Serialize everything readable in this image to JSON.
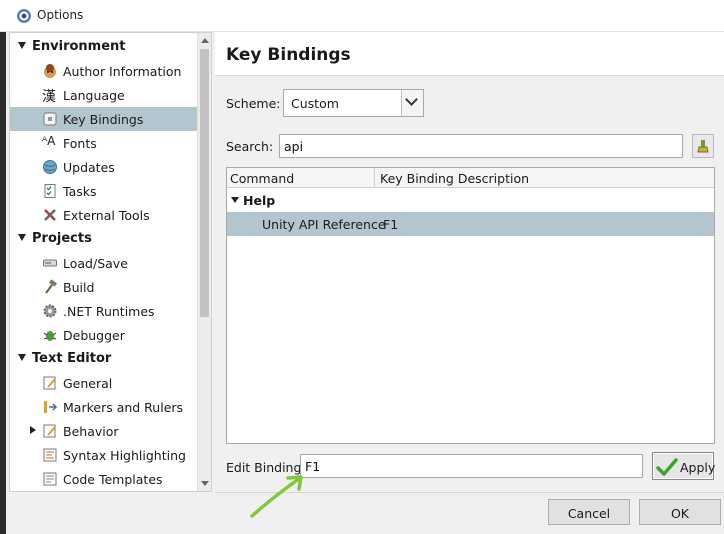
{
  "window": {
    "title": "Options"
  },
  "sidebar": {
    "categories": [
      {
        "label": "Environment",
        "items": [
          {
            "label": "Author Information",
            "icon": "author-face-icon"
          },
          {
            "label": "Language",
            "icon": "kanji-icon",
            "glyph": "漢"
          },
          {
            "label": "Key Bindings",
            "icon": "keyboard-key-icon",
            "selected": true
          },
          {
            "label": "Fonts",
            "icon": "font-size-icon",
            "glyph": "ᴬA"
          },
          {
            "label": "Updates",
            "icon": "globe-icon"
          },
          {
            "label": "Tasks",
            "icon": "checklist-icon"
          },
          {
            "label": "External Tools",
            "icon": "tools-icon"
          }
        ]
      },
      {
        "label": "Projects",
        "items": [
          {
            "label": "Load/Save",
            "icon": "disk-drive-icon"
          },
          {
            "label": "Build",
            "icon": "hammer-icon"
          },
          {
            "label": ".NET Runtimes",
            "icon": "gear-icon"
          },
          {
            "label": "Debugger",
            "icon": "bug-icon"
          }
        ]
      },
      {
        "label": "Text Editor",
        "items": [
          {
            "label": "General",
            "icon": "document-pencil-icon"
          },
          {
            "label": "Markers and Rulers",
            "icon": "markers-icon"
          },
          {
            "label": "Behavior",
            "icon": "document-pencil-icon",
            "expandable": true
          },
          {
            "label": "Syntax Highlighting",
            "icon": "document-lines-icon"
          },
          {
            "label": "Code Templates",
            "icon": "template-icon"
          }
        ]
      }
    ]
  },
  "page": {
    "title": "Key Bindings"
  },
  "scheme": {
    "label": "Scheme:",
    "value": "Custom"
  },
  "search": {
    "label": "Search:",
    "value": "api"
  },
  "table": {
    "columns": [
      "Command",
      "Key Binding Description"
    ],
    "group": "Help",
    "rows": [
      {
        "command": "Unity API Reference",
        "binding": "F1"
      }
    ]
  },
  "edit_binding": {
    "label": "Edit Binding",
    "value": "F1"
  },
  "buttons": {
    "apply": "Apply",
    "cancel": "Cancel",
    "ok": "OK"
  },
  "colors": {
    "selection": "#b3c6cf",
    "annotation_arrow": "#7ec83a",
    "apply_check": "#3aa629"
  }
}
